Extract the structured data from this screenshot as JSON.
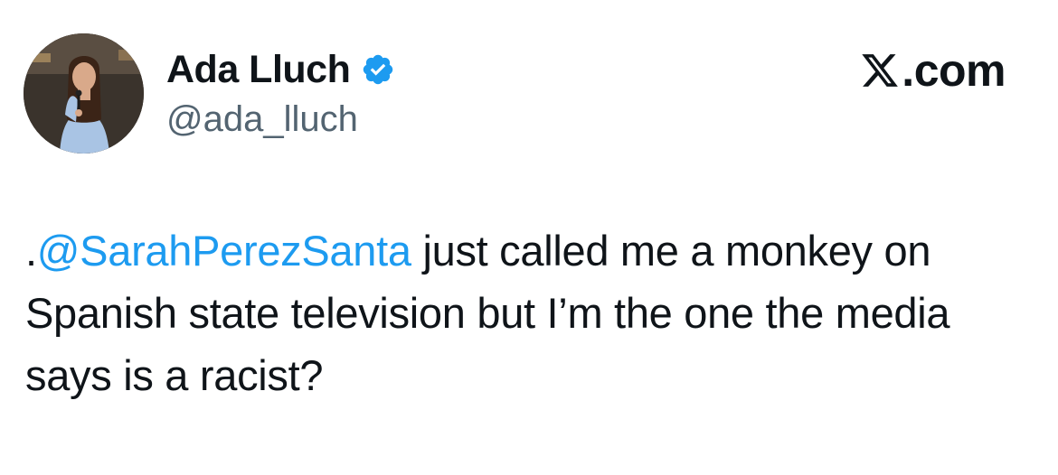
{
  "author": {
    "display_name": "Ada Lluch",
    "handle": "@ada_lluch",
    "verified": true,
    "verified_icon": "verified-badge-icon",
    "avatar": "profile-photo-woman-with-microphone"
  },
  "brand": {
    "logo_icon": "x-logo-icon",
    "text": ".com"
  },
  "tweet": {
    "prefix": ".",
    "mention": "@SarahPerezSanta",
    "text": " just called me a monkey on Spanish state television but I’m the one the media says is a racist?"
  },
  "colors": {
    "mention": "#1d9bf0",
    "verified": "#1d9bf0",
    "handle": "#536471",
    "text": "#0f1419"
  }
}
